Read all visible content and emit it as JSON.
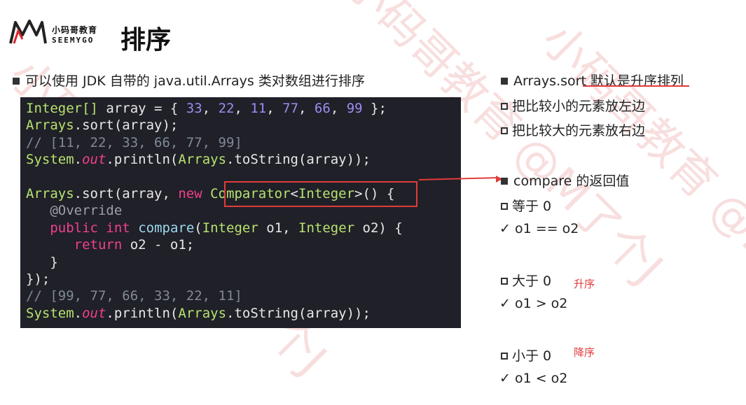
{
  "brand": {
    "name_cn": "小码哥教育",
    "name_en": "SEEMYGO"
  },
  "title": "排序",
  "intro": "可以使用 JDK 自带的 java.util.Arrays 类对数组进行排序",
  "right": {
    "sort_default": "Arrays.sort 默认是升序排列",
    "smaller_left": "把比较小的元素放左边",
    "larger_right": "把比较大的元素放右边",
    "compare_return": "compare 的返回值",
    "eq_label": "等于 0",
    "eq_result": "o1 == o2",
    "gt_label": "大于 0",
    "gt_result": "o1 > o2",
    "gt_note": "升序",
    "lt_label": "小于 0",
    "lt_result": "o1 < o2",
    "lt_note": "降序"
  },
  "code": {
    "l1": {
      "type": "Integer[]",
      "rest": " array = { ",
      "n1": "33",
      "n2": "22",
      "n3": "11",
      "n4": "77",
      "n5": "66",
      "n6": "99",
      "end": " };"
    },
    "l2": {
      "cls": "Arrays",
      "rest": ".sort(array);"
    },
    "l3": "// [11, 22, 33, 66, 77, 99]",
    "l4": {
      "cls": "System",
      "dot": ".",
      "field": "out",
      "mid": ".println(",
      "cls2": "Arrays",
      "fn": ".toString",
      "end": "(array));"
    },
    "l6": {
      "cls": "Arrays",
      "mid": ".sort(array, ",
      "kw": "new",
      "sp": " ",
      "cls2": "Comparator",
      "lt": "<",
      "cls3": "Integer",
      "end": ">() {"
    },
    "l7": "@Override",
    "l8": {
      "kw1": "public",
      "kw2": "int",
      "fn": "compare",
      "p1": "(",
      "cls1": "Integer",
      "a": " o1, ",
      "cls2": "Integer",
      "b": " o2) {"
    },
    "l9": {
      "kw": "return",
      "rest": " o2 - o1;"
    },
    "l10": "}",
    "l11": "});",
    "l12": "// [99, 77, 66, 33, 22, 11]",
    "l13": {
      "cls": "System",
      "dot": ".",
      "field": "out",
      "mid": ".println(",
      "cls2": "Arrays",
      "fn": ".toString",
      "end": "(array));"
    }
  },
  "watermark": "小码哥教育 @M了个J",
  "colors": {
    "accent_red": "#e23b3b",
    "code_bg": "#202028"
  }
}
